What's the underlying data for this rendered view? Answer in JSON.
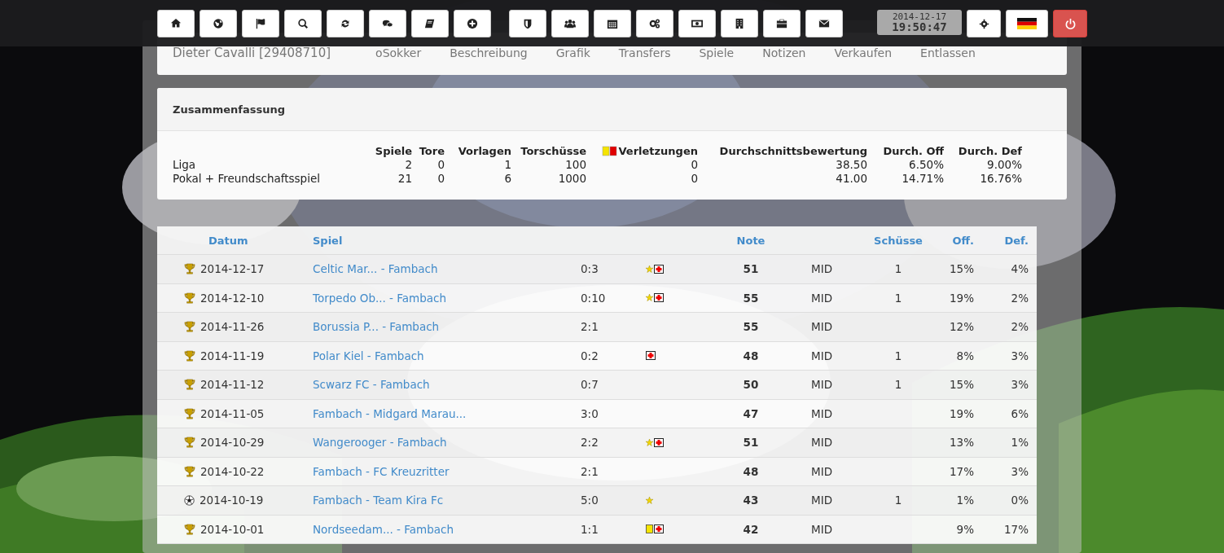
{
  "clock": {
    "date": "2014-12-17",
    "time": "19:50:47"
  },
  "profile": {
    "name": "Dieter Cavalli [29408710]",
    "links": [
      "oSokker",
      "Beschreibung",
      "Grafik",
      "Transfers",
      "Spiele",
      "Notizen",
      "Verkaufen",
      "Entlassen"
    ]
  },
  "summary": {
    "title": "Zusammenfassung",
    "columns": [
      "Spiele",
      "Tore",
      "Vorlagen",
      "Torschüsse",
      "Verletzungen",
      "Durchschnittsbewertung",
      "Durch. Off",
      "Durch. Def"
    ],
    "rows": [
      {
        "label": "Liga",
        "values": [
          "2",
          "0",
          "1",
          "100",
          "0",
          "38.50",
          "6.50%",
          "9.00%"
        ]
      },
      {
        "label": "Pokal + Freundschaftsspiel",
        "values": [
          "21",
          "0",
          "6",
          "1000",
          "0",
          "41.00",
          "14.71%",
          "16.76%"
        ]
      }
    ]
  },
  "matches": {
    "columns": {
      "date": "Datum",
      "match": "Spiel",
      "note": "Note",
      "shots": "Schüsse",
      "off": "Off.",
      "def": "Def."
    },
    "rows": [
      {
        "kind": "cup",
        "date": "2014-12-17",
        "match": "Celtic Mar... - Fambach",
        "score": "0:3",
        "events": [
          {
            "kind": "star"
          },
          {
            "kind": "injury"
          }
        ],
        "note": "51",
        "position": "MID",
        "shots": "1",
        "off": "15%",
        "def": "4%"
      },
      {
        "kind": "cup",
        "date": "2014-12-10",
        "match": "Torpedo Ob... - Fambach",
        "score": "0:10",
        "events": [
          {
            "kind": "star"
          },
          {
            "kind": "injury"
          }
        ],
        "note": "55",
        "position": "MID",
        "shots": "1",
        "off": "19%",
        "def": "2%"
      },
      {
        "kind": "cup",
        "date": "2014-11-26",
        "match": "Borussia P... - Fambach",
        "score": "2:1",
        "events": [],
        "note": "55",
        "position": "MID",
        "off": "12%",
        "def": "2%"
      },
      {
        "kind": "cup",
        "date": "2014-11-19",
        "match": "Polar Kiel - Fambach",
        "score": "0:2",
        "events": [
          {
            "kind": "injury"
          }
        ],
        "note": "48",
        "position": "MID",
        "shots": "1",
        "off": "8%",
        "def": "3%"
      },
      {
        "kind": "cup",
        "date": "2014-11-12",
        "match": "Scwarz FC - Fambach",
        "score": "0:7",
        "events": [],
        "note": "50",
        "position": "MID",
        "shots": "1",
        "off": "15%",
        "def": "3%"
      },
      {
        "kind": "cup",
        "date": "2014-11-05",
        "match": "Fambach - Midgard Marau...",
        "score": "3:0",
        "events": [],
        "note": "47",
        "position": "MID",
        "off": "19%",
        "def": "6%"
      },
      {
        "kind": "cup",
        "date": "2014-10-29",
        "match": "Wangerooger - Fambach",
        "score": "2:2",
        "events": [
          {
            "kind": "star"
          },
          {
            "kind": "injury"
          }
        ],
        "note": "51",
        "position": "MID",
        "off": "13%",
        "def": "1%"
      },
      {
        "kind": "cup",
        "date": "2014-10-22",
        "match": "Fambach - FC Kreuzritter",
        "score": "2:1",
        "events": [],
        "note": "48",
        "position": "MID",
        "off": "17%",
        "def": "3%"
      },
      {
        "kind": "friendly",
        "date": "2014-10-19",
        "match": "Fambach - Team Kira Fc",
        "score": "5:0",
        "events": [
          {
            "kind": "star"
          }
        ],
        "note": "43",
        "position": "MID",
        "shots": "1",
        "off": "1%",
        "def": "0%"
      },
      {
        "kind": "cup",
        "date": "2014-10-01",
        "match": "Nordseedam... - Fambach",
        "score": "1:1",
        "events": [
          {
            "kind": "booking"
          },
          {
            "kind": "injury"
          }
        ],
        "note": "42",
        "position": "MID",
        "off": "9%",
        "def": "17%"
      }
    ]
  }
}
